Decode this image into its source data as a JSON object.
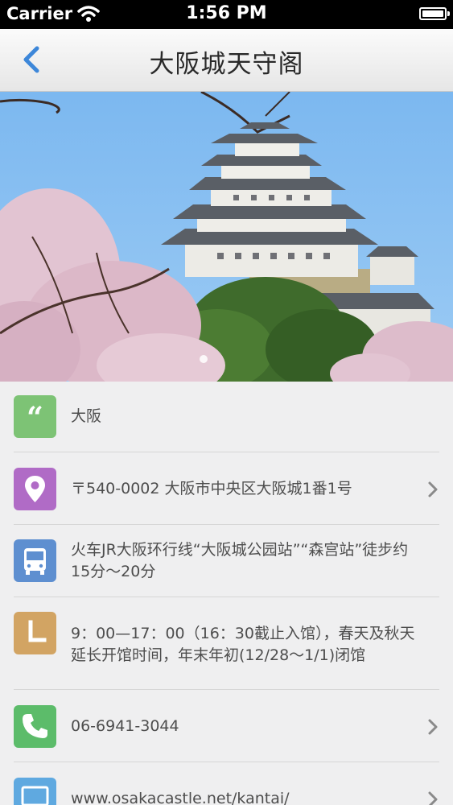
{
  "status_bar": {
    "carrier": "Carrier",
    "time": "1:56 PM"
  },
  "nav": {
    "title": "大阪城天守阁"
  },
  "colors": {
    "quote": "#7dc375",
    "location": "#b06bc6",
    "bus": "#5e8fd0",
    "clock": "#d2a463",
    "phone": "#5cbc6a",
    "web": "#5fa9e0"
  },
  "info": {
    "region": "大阪",
    "address": "〒540-0002 大阪市中央区大阪城1番1号",
    "transport": "火车JR大阪环行线“大阪城公园站”“森宫站”徒步约15分～20分",
    "hours": "9：00—17：00（16：30截止入馆），春天及秋天延长开馆时间，年末年初(12/28～1/1)闭馆",
    "phone": "06-6941-3044",
    "website": "www.osakacastle.net/kantai/"
  }
}
